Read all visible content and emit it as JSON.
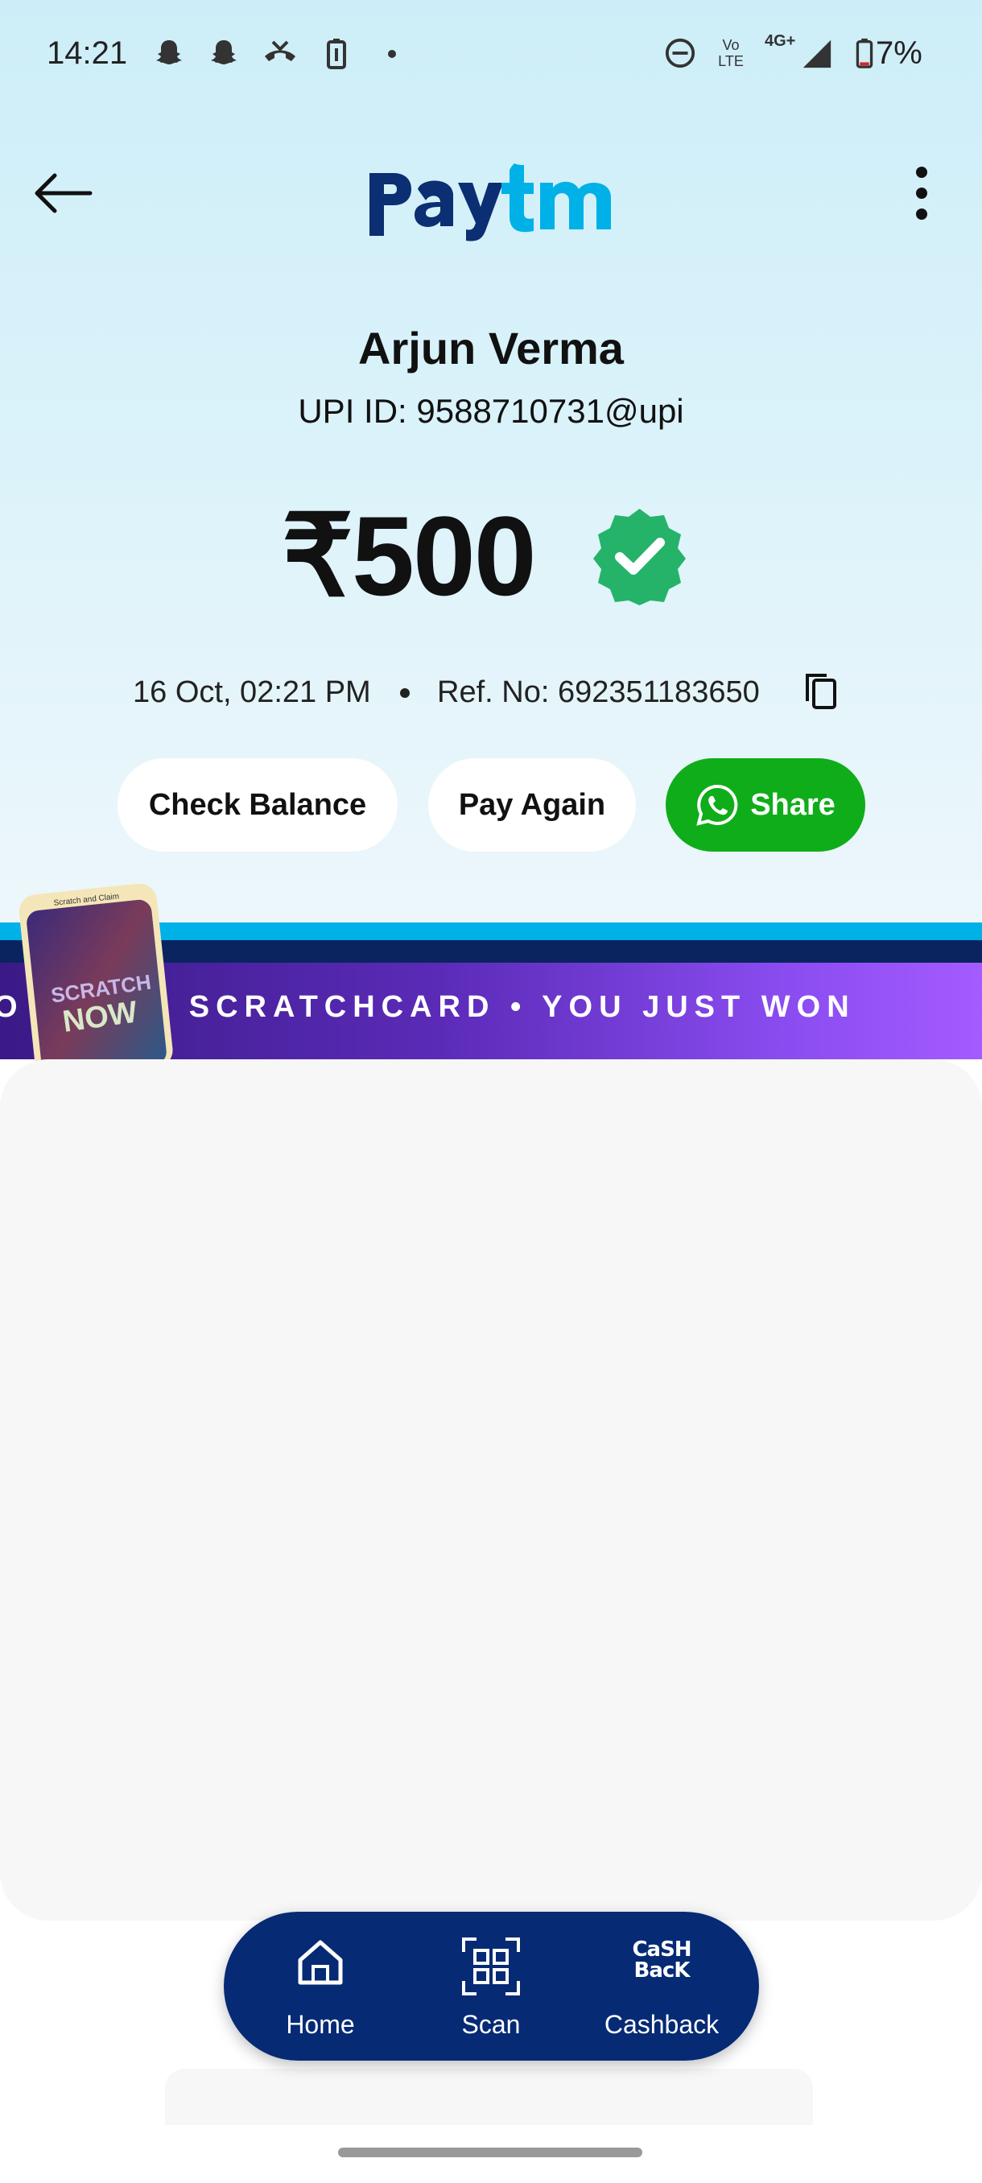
{
  "status_bar": {
    "time": "14:21",
    "network": "4G+",
    "volte": "Vo LTE",
    "battery": "7%",
    "icons": [
      "snapchat-icon",
      "snapchat-icon",
      "missed-call-icon",
      "battery-saver-icon",
      "dot-icon",
      "dnd-icon",
      "signal-icon",
      "battery-icon"
    ]
  },
  "header": {
    "brand": "Paytm",
    "back_icon": "arrow-left-icon",
    "menu_icon": "more-vertical-icon"
  },
  "payment": {
    "payee_name": "Arjun Verma",
    "upi_id": "UPI ID: 9588710731@upi",
    "amount": "₹500",
    "status_icon": "success-check-icon",
    "date_time": "16 Oct, 02:21 PM",
    "ref_no": "Ref. No: 692351183650",
    "success_color": "#25b36a"
  },
  "actions": {
    "check_balance": "Check Balance",
    "pay_again": "Pay Again",
    "share": "Share",
    "share_color": "#0fad1a"
  },
  "banner": {
    "marquee_text": "O  WON A SCRATCHCARD • YOU JUST WON",
    "card_top": "Scratch and Claim",
    "card_line1": "SCRATCH",
    "card_line2": "NOW"
  },
  "bottom_nav": {
    "items": [
      {
        "label": "Home",
        "icon": "home-icon"
      },
      {
        "label": "Scan",
        "icon": "scan-qr-icon"
      },
      {
        "label": "Cashback",
        "icon": "cashback-icon"
      }
    ],
    "cashback_icon_text_1": "CaSH",
    "cashback_icon_text_2": "BacK",
    "color": "#062a74"
  }
}
